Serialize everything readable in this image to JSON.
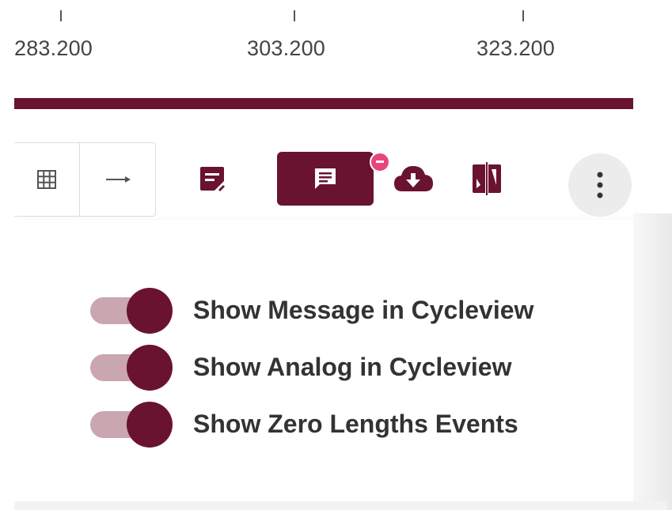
{
  "axis": {
    "ticks": [
      "283.200",
      "303.200",
      "323.200"
    ]
  },
  "colors": {
    "accent": "#6a1330",
    "track": "#c9a6b0",
    "badge": "#e8467a"
  },
  "toolbar": {
    "buttons": [
      {
        "icon": "grid-icon",
        "state": "default"
      },
      {
        "icon": "arrow-right-icon",
        "state": "default"
      },
      {
        "icon": "note-edit-icon",
        "state": "default"
      },
      {
        "icon": "message-icon",
        "state": "active",
        "badge": true
      },
      {
        "icon": "cloud-download-icon",
        "state": "default"
      },
      {
        "icon": "split-view-icon",
        "state": "default"
      },
      {
        "icon": "more-vertical-icon",
        "state": "default"
      }
    ]
  },
  "panel": {
    "toggles": [
      {
        "label": "Show Message in Cycleview",
        "checked": true
      },
      {
        "label": "Show Analog in Cycleview",
        "checked": true
      },
      {
        "label": "Show Zero Lengths Events",
        "checked": true
      }
    ]
  }
}
